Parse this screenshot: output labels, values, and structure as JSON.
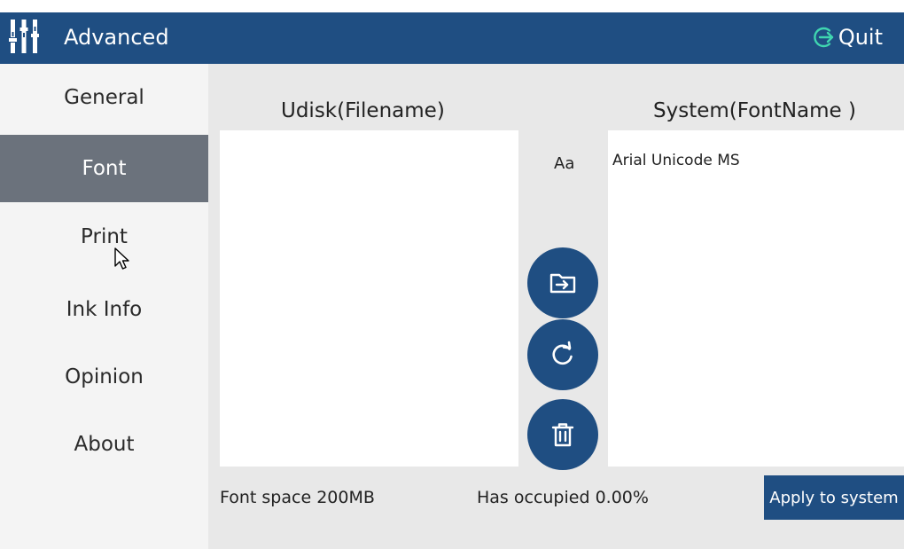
{
  "header": {
    "title": "Advanced",
    "logo_icon": "equalizer-sliders-icon",
    "quit_label": "Quit",
    "quit_icon": "exit-arrow-icon"
  },
  "sidebar": {
    "items": [
      {
        "label": "General",
        "active": false
      },
      {
        "label": "Font",
        "active": true
      },
      {
        "label": "Print",
        "active": false
      },
      {
        "label": "Ink Info",
        "active": false
      },
      {
        "label": "Opinion",
        "active": false
      },
      {
        "label": "About",
        "active": false
      }
    ]
  },
  "font_panel": {
    "udisk_title": "Udisk(Filename)",
    "system_title": "System(FontName )",
    "udisk_files": [],
    "system_fonts": [
      "Arial Unicode MS"
    ],
    "preview_label": "Aa",
    "buttons": {
      "import_icon": "folder-import-icon",
      "refresh_icon": "refresh-icon",
      "delete_icon": "trash-icon"
    },
    "font_space_label": "Font space",
    "font_space_value": "200MB",
    "occupied_label": "Has occupied",
    "occupied_value": "0.00%",
    "apply_label": "Apply to system"
  },
  "colors": {
    "primary": "#1f4e82",
    "sidebar_active": "#6b727c",
    "content_bg": "#e8e8e8",
    "quit_icon": "#3fd6b0"
  }
}
